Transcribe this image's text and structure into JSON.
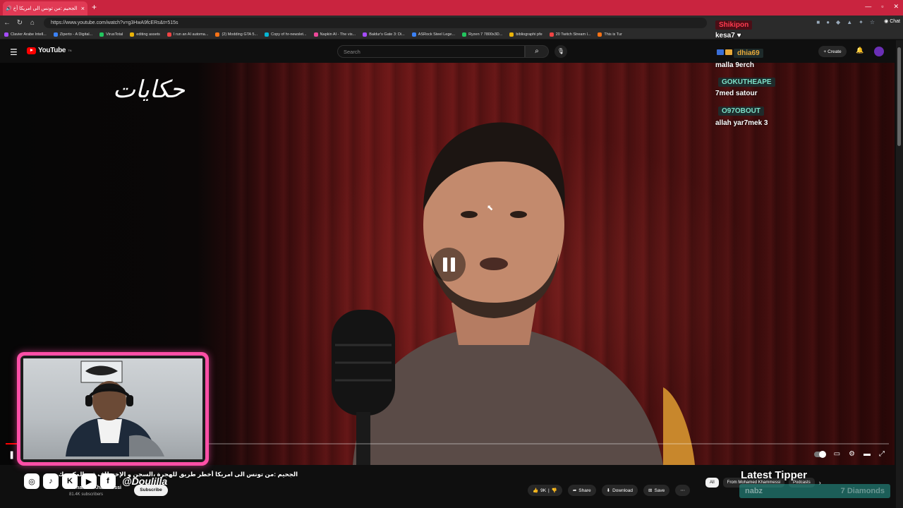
{
  "browser": {
    "tab_title": "الجحيم :من تونس الى امريكا أخ",
    "url": "https://www.youtube.com/watch?v=g3HwA9fcERs&t=515s",
    "bookmarks": [
      "Clavier Arabe Intell...",
      "Ziperto - A Digital...",
      "VirusTotal",
      "editing assets",
      "I run an AI automa...",
      "(2) Modding GTA 5...",
      "Copy of hr-newslet...",
      "Napkin AI - The vis...",
      "Baldur's Gate 3: Di...",
      "ASRock Steel Lege...",
      "Ryzen 7 7800x3D...",
      "bibliographi pfe",
      "20 Twitch Stream l...",
      "This is Tur"
    ],
    "chat_label": "Chat"
  },
  "youtube": {
    "logo_text": "YouTube",
    "logo_region": "TN",
    "search_placeholder": "Search",
    "create_label": "Create"
  },
  "video": {
    "overlay_logo": "حكايات",
    "progress": 0.016
  },
  "stream_chat": {
    "messages": [
      {
        "user": "Shikipon",
        "text": "kesa7 ♥"
      },
      {
        "user": "dhia69",
        "text": "malla 9erch"
      },
      {
        "user": "GOKUTHEAPE",
        "text": "7med satour"
      },
      {
        "user": "O97OBOUT",
        "text": "allah yar7mek 3"
      }
    ]
  },
  "below": {
    "title": "الجحيم :من تونس الى امريكا أخطر طريق للهجرة ،السجن و الإختطاف في المكسيك من الداخل حكايات!!",
    "social_handle": "@Doulilla",
    "channel_name": "Mohamed Khammessi",
    "subscribers": "81.4K subscribers",
    "subscribe_label": "Subscribe",
    "likes": "9K",
    "share_label": "Share",
    "download_label": "Download",
    "save_label": "Save",
    "chips": [
      "All",
      "From Mohamed Khammessi",
      "Podcasts"
    ]
  },
  "tipper": {
    "title": "Latest Tipper",
    "name": "nabz",
    "amount": "7 Diamonds"
  },
  "colors": {
    "tab_red": "#c9243f",
    "webcam_border": "#ff4fa7",
    "yt_red": "#ff0000"
  }
}
